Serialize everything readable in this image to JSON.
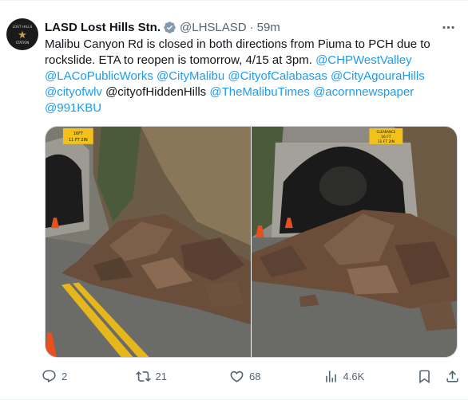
{
  "account": {
    "name": "LASD Lost Hills Stn.",
    "handle": "@LHSLASD",
    "separator": "·",
    "time": "59m",
    "avatar_text_top": "LOST HILLS",
    "avatar_text_bottom": "STATION"
  },
  "tweet": {
    "text_line1": "Malibu Canyon Rd is closed in both directions from Piuma to PCH due to rockslide. ETA to reopen is tomorrow, 4/15 at 3pm.",
    "mentions": {
      "m1": "@CHPWestValley",
      "m2": "@LACoPublicWorks",
      "m3": "@CityMalibu",
      "m4": "@CityofCalabasas",
      "m5": "@CityAgouraHills",
      "m6": "@cityofwlv",
      "m7": "@TheMalibuTimes",
      "m8": "@acornnewspaper",
      "m9": "@991KBU"
    },
    "plain_mention": "@cityofHiddenHills"
  },
  "media": {
    "sign_left_1": "16FT",
    "sign_left_2": "11 FT 2IN",
    "sign_right_1": "CLEARANCE",
    "sign_right_2": "16 FT",
    "sign_right_3": "11 FT 2IN"
  },
  "actions": {
    "replies": "2",
    "reposts": "21",
    "likes": "68",
    "views": "4.6K"
  },
  "colors": {
    "link": "#1d9bf0",
    "secondary": "#536471",
    "verified": "#829aab"
  }
}
